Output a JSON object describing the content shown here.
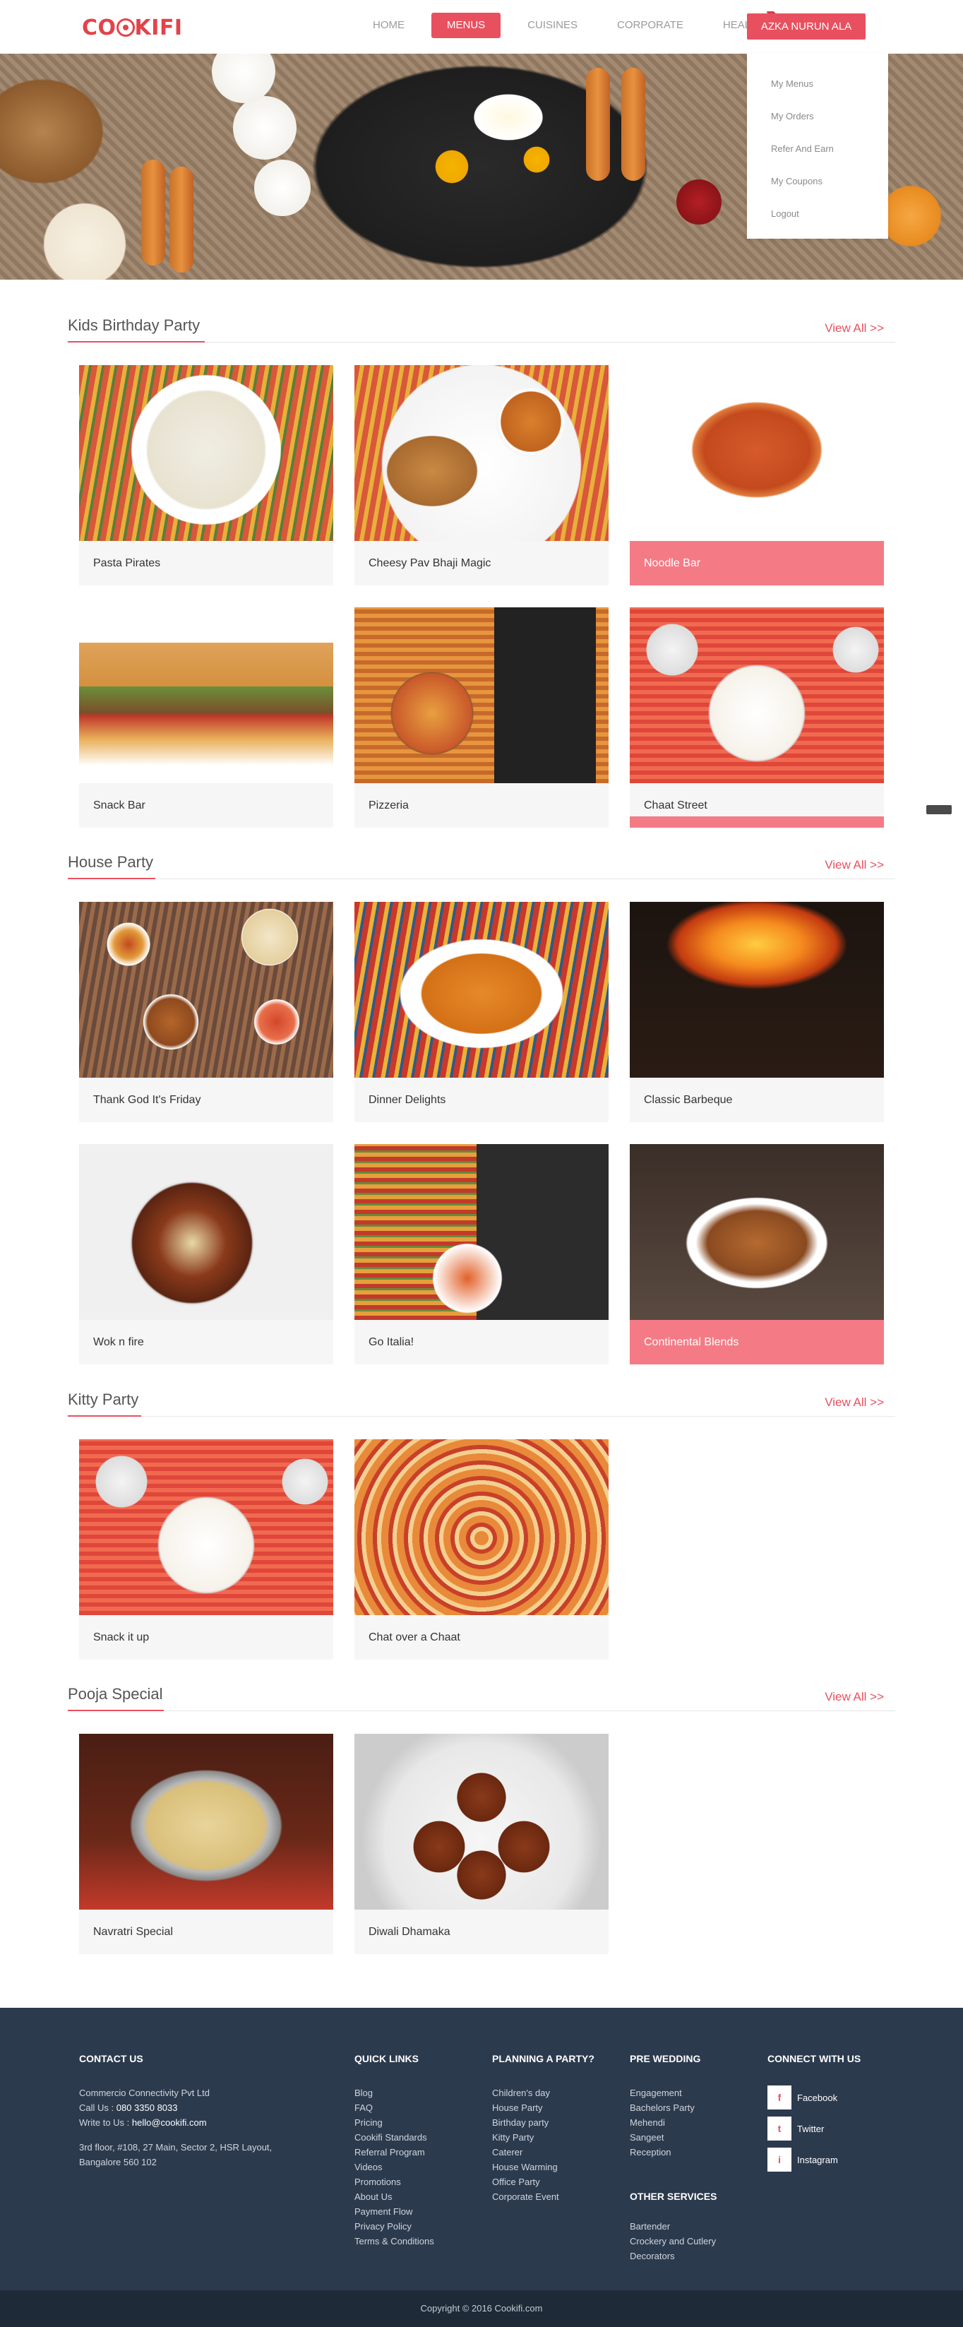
{
  "header": {
    "logo": "COOKIFI",
    "nav": [
      "HOME",
      "MENUS",
      "CUISINES",
      "CORPORATE",
      "HEALTHY"
    ],
    "active_nav": "MENUS",
    "user_button": "AZKA NURUN ALA"
  },
  "user_menu": [
    "My Menus",
    "My Orders",
    "Refer And Earn",
    "My Coupons",
    "Logout"
  ],
  "sections": [
    {
      "title": "Kids Birthday Party",
      "view_all": "View All >>",
      "items": [
        "Pasta Pirates",
        "Cheesy Pav Bhaji Magic",
        "Noodle Bar",
        "Snack Bar",
        "Pizzeria",
        "Chaat Street"
      ]
    },
    {
      "title": "House Party",
      "view_all": "View All >>",
      "items": [
        "Thank God It's Friday",
        "Dinner Delights",
        "Classic Barbeque",
        "Wok n fire",
        "Go Italia!",
        "Continental Blends"
      ]
    },
    {
      "title": "Kitty Party",
      "view_all": "View All >>",
      "items": [
        "Snack it up",
        "Chat over a Chaat"
      ]
    },
    {
      "title": "Pooja Special",
      "view_all": "View All >>",
      "items": [
        "Navratri Special",
        "Diwali Dhamaka"
      ]
    }
  ],
  "footer": {
    "contact": {
      "heading": "CONTACT US",
      "company": "Commercio Connectivity Pvt Ltd",
      "call_label": "Call Us : ",
      "phone": "080 3350 8033",
      "write_label": "Write to Us : ",
      "email": "hello@cookifi.com",
      "address1": "3rd floor, #108, 27 Main, Sector 2, HSR Layout,",
      "address2": "Bangalore 560 102"
    },
    "quick_links": {
      "heading": "QUICK LINKS",
      "links": [
        "Blog",
        "FAQ",
        "Pricing",
        "Cookifi Standards",
        "Referral Program",
        "Videos",
        "Promotions",
        "About Us",
        "Payment Flow",
        "Privacy Policy",
        "Terms & Conditions"
      ]
    },
    "planning": {
      "heading": "PLANNING A PARTY?",
      "links": [
        "Children's day",
        "House Party",
        "Birthday party",
        "Kitty Party",
        "Caterer",
        "House Warming",
        "Office Party",
        "Corporate Event"
      ]
    },
    "pre_wedding": {
      "heading": "PRE WEDDING",
      "links": [
        "Engagement",
        "Bachelors Party",
        "Mehendi",
        "Sangeet",
        "Reception"
      ]
    },
    "other_services": {
      "heading": "OTHER SERVICES",
      "links": [
        "Bartender",
        "Crockery and Cutlery",
        "Decorators"
      ]
    },
    "connect": {
      "heading": "CONNECT WITH US",
      "links": [
        {
          "label": "Facebook",
          "icon": "f"
        },
        {
          "label": "Twitter",
          "icon": "t"
        },
        {
          "label": "Instagram",
          "icon": "i"
        }
      ]
    },
    "copyright": "Copyright © 2016 Cookifi.com"
  },
  "colors": {
    "accent": "#e9505f",
    "footer_bg": "#2c3a4e",
    "highlight_caption": "#f47b86"
  }
}
